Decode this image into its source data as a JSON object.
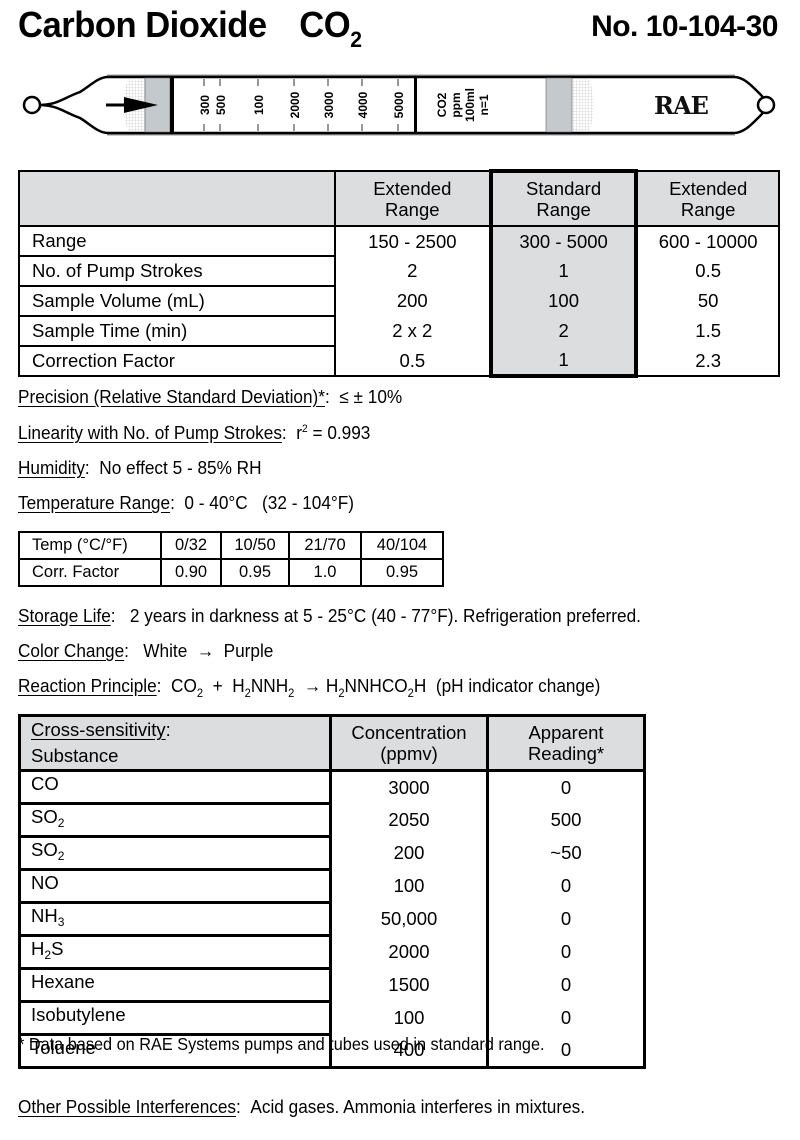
{
  "header": {
    "title": "Carbon Dioxide",
    "formula_base": "CO",
    "formula_sub": "2",
    "catalog_number": "No. 10-104-30"
  },
  "tube": {
    "scale_labels": [
      "300",
      "500",
      "100",
      "2000",
      "3000",
      "4000",
      "5000"
    ],
    "info_labels": [
      "CO2",
      "ppm",
      "100ml",
      "n=1"
    ],
    "brand": "RAE",
    "flow_direction_icon": "arrow-right-icon",
    "colors": {
      "packing": "#c3c9cc",
      "outline": "#000000"
    }
  },
  "range_table": {
    "columns": [
      {
        "line1": "Extended",
        "line2": "Range"
      },
      {
        "line1": "Standard",
        "line2": "Range"
      },
      {
        "line1": "Extended",
        "line2": "Range"
      }
    ],
    "rows": [
      {
        "label": "Range",
        "values": [
          "150 - 2500",
          "300 - 5000",
          "600 - 10000"
        ]
      },
      {
        "label": "No. of Pump Strokes",
        "values": [
          "2",
          "1",
          "0.5"
        ]
      },
      {
        "label": "Sample Volume (mL)",
        "values": [
          "200",
          "100",
          "50"
        ]
      },
      {
        "label": "Sample Time (min)",
        "values": [
          "2 x 2",
          "2",
          "1.5"
        ]
      },
      {
        "label": "Correction Factor",
        "values": [
          "0.5",
          "1",
          "2.3"
        ]
      }
    ],
    "header_bg": "#dcdddf"
  },
  "specs": {
    "precision": {
      "key": "Precision (Relative Standard Deviation)*",
      "value": "≤ ± 10%"
    },
    "linearity": {
      "key": "Linearity with No. of Pump Strokes",
      "value_prefix": "r",
      "value_sup": "2",
      "value_suffix": " = 0.993"
    },
    "humidity": {
      "key": "Humidity",
      "value": "No effect 5 - 85% RH"
    },
    "temperature": {
      "key": "Temperature Range",
      "value": "0 - 40°C   (32 - 104°F)"
    }
  },
  "temp_table": {
    "header_label": "Temp (°C/°F)",
    "temps": [
      "0/32",
      "10/50",
      "21/70",
      "40/104"
    ],
    "factor_label": "Corr. Factor",
    "factors": [
      "0.90",
      "0.95",
      "1.0",
      "0.95"
    ]
  },
  "storage": {
    "key": "Storage Life",
    "value": "2 years in darkness at 5 - 25°C (40 - 77°F). Refrigeration preferred."
  },
  "color_change": {
    "key": "Color Change",
    "from": "White",
    "arrow": "→",
    "to": "Purple"
  },
  "reaction": {
    "key": "Reaction Principle",
    "parts": [
      {
        "t": "CO"
      },
      {
        "sub": "2"
      },
      {
        "t": "  +  H"
      },
      {
        "sub": "2"
      },
      {
        "t": "NNH"
      },
      {
        "sub": "2"
      },
      {
        "t": "  → H"
      },
      {
        "sub": "2"
      },
      {
        "t": "NNHCO"
      },
      {
        "sub": "2"
      },
      {
        "t": "H  (pH indicator change)"
      }
    ]
  },
  "cross_table": {
    "title": "Cross-sensitivity",
    "substance_label": "Substance",
    "conc_header": {
      "line1": "Concentration",
      "line2": "(ppmv)"
    },
    "reading_header": {
      "line1": "Apparent",
      "line2": "Reading*"
    },
    "rows": [
      {
        "base": "CO",
        "sub": "",
        "tail": "",
        "conc": "3000",
        "reading": "0"
      },
      {
        "base": "SO",
        "sub": "2",
        "tail": "",
        "conc": "2050",
        "reading": "500"
      },
      {
        "base": "SO",
        "sub": "2",
        "tail": "",
        "conc": "200",
        "reading": "~50"
      },
      {
        "base": "NO",
        "sub": "",
        "tail": "",
        "conc": "100",
        "reading": "0"
      },
      {
        "base": "NH",
        "sub": "3",
        "tail": "",
        "conc": "50,000",
        "reading": "0"
      },
      {
        "base": "H",
        "sub": "2",
        "tail": "S",
        "conc": "2000",
        "reading": "0"
      },
      {
        "base": "Hexane",
        "sub": "",
        "tail": "",
        "conc": "1500",
        "reading": "0"
      },
      {
        "base": "Isobutylene",
        "sub": "",
        "tail": "",
        "conc": "100",
        "reading": "0"
      },
      {
        "base": "Toluene",
        "sub": "",
        "tail": "",
        "conc": "400",
        "reading": "0"
      }
    ]
  },
  "footnote": "* Data based on RAE Systems pumps and tubes used in standard range.",
  "other_interferences": {
    "key": "Other Possible Interferences",
    "value": "Acid gases.  Ammonia interferes in mixtures."
  }
}
